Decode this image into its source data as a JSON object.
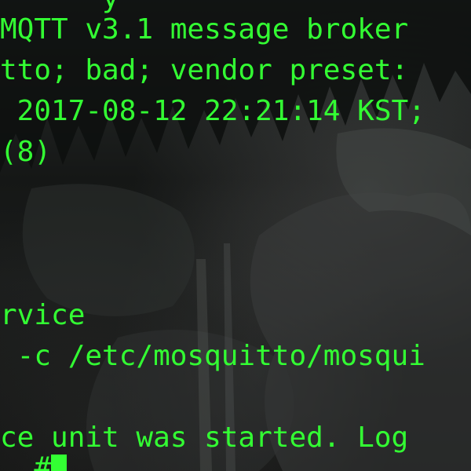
{
  "terminal": {
    "lines": [
      "      y        ",
      "MQTT v3.1 message broker",
      "tto; bad; vendor preset:",
      " 2017-08-12 22:21:14 KST;",
      "(8)",
      "",
      "",
      "",
      "rvice",
      " -c /etc/mosquitto/mosqui",
      "",
      "ce unit was started. Log",
      "  #"
    ],
    "text_color": "#33ff33"
  }
}
